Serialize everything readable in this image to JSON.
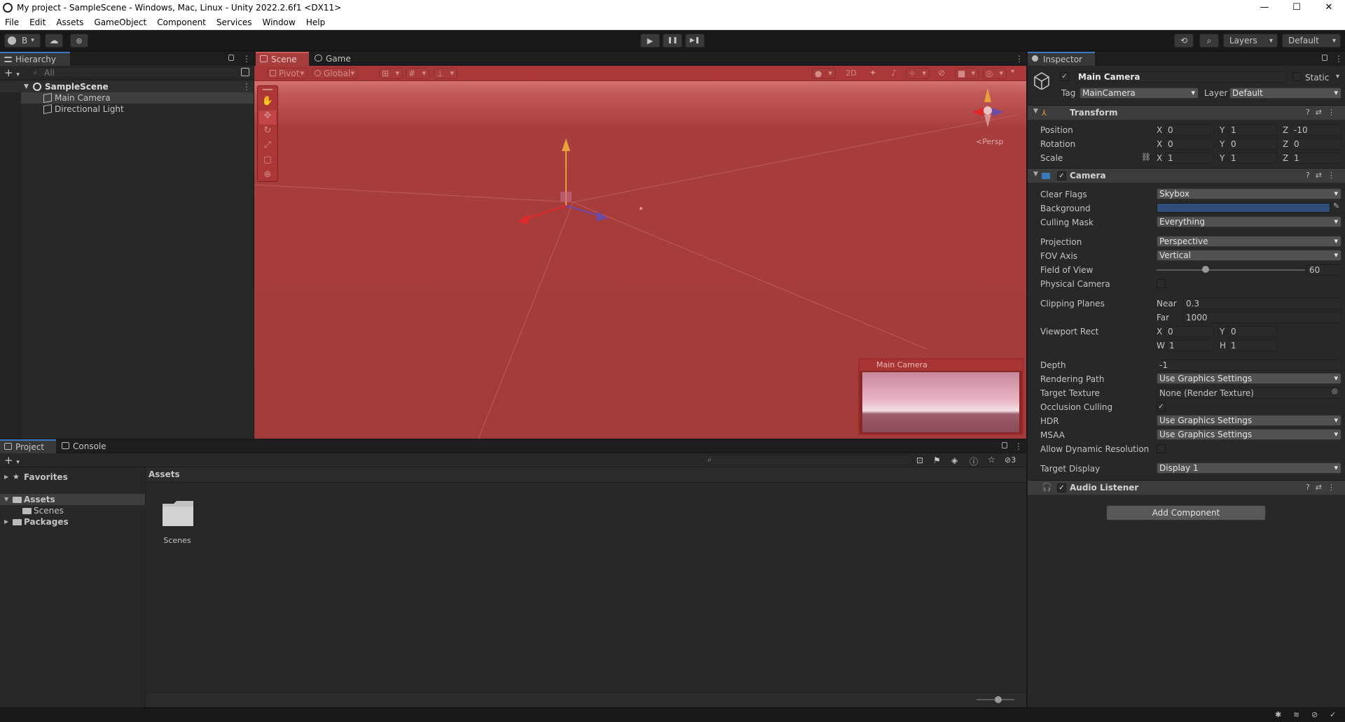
{
  "window": {
    "title": "My project - SampleScene - Windows, Mac, Linux - Unity 2022.2.6f1 <DX11>",
    "min": "—",
    "max": "☐",
    "close": "✕"
  },
  "menu": [
    "File",
    "Edit",
    "Assets",
    "GameObject",
    "Component",
    "Services",
    "Window",
    "Help"
  ],
  "toolbar": {
    "account": "B",
    "layers": "Layers",
    "layout": "Default",
    "play": "▶",
    "pause": "❚❚",
    "step": "▶❚"
  },
  "hierarchy": {
    "tab": "Hierarchy",
    "search_placeholder": "All",
    "scene": "SampleScene",
    "items": [
      "Main Camera",
      "Directional Light"
    ]
  },
  "scene_view": {
    "tabs": [
      "Scene",
      "Game"
    ],
    "pivot": "Pivot",
    "global": "Global",
    "mode_2d": "2D",
    "persp": "<Persp",
    "camera_preview_title": "Main Camera"
  },
  "inspector": {
    "tab": "Inspector",
    "object_name": "Main Camera",
    "static_label": "Static",
    "tag_label": "Tag",
    "tag_value": "MainCamera",
    "layer_label": "Layer",
    "layer_value": "Default",
    "transform": {
      "title": "Transform",
      "position_label": "Position",
      "rotation_label": "Rotation",
      "scale_label": "Scale",
      "position": {
        "x": "0",
        "y": "1",
        "z": "-10"
      },
      "rotation": {
        "x": "0",
        "y": "0",
        "z": "0"
      },
      "scale": {
        "x": "1",
        "y": "1",
        "z": "1"
      }
    },
    "camera": {
      "title": "Camera",
      "clear_flags_label": "Clear Flags",
      "clear_flags": "Skybox",
      "background_label": "Background",
      "background_color": "#314d79",
      "culling_mask_label": "Culling Mask",
      "culling_mask": "Everything",
      "projection_label": "Projection",
      "projection": "Perspective",
      "fov_axis_label": "FOV Axis",
      "fov_axis": "Vertical",
      "fov_label": "Field of View",
      "fov": "60",
      "fov_fraction": 0.33,
      "physical_label": "Physical Camera",
      "clipping_label": "Clipping Planes",
      "near_label": "Near",
      "near": "0.3",
      "far_label": "Far",
      "far": "1000",
      "viewport_label": "Viewport Rect",
      "viewport": {
        "x": "0",
        "y": "0",
        "w": "1",
        "h": "1"
      },
      "depth_label": "Depth",
      "depth": "-1",
      "rendering_path_label": "Rendering Path",
      "rendering_path": "Use Graphics Settings",
      "target_texture_label": "Target Texture",
      "target_texture": "None (Render Texture)",
      "occlusion_label": "Occlusion Culling",
      "hdr_label": "HDR",
      "hdr": "Use Graphics Settings",
      "msaa_label": "MSAA",
      "msaa": "Use Graphics Settings",
      "dynres_label": "Allow Dynamic Resolution",
      "target_display_label": "Target Display",
      "target_display": "Display 1"
    },
    "audio_listener": {
      "title": "Audio Listener"
    },
    "add_component": "Add Component"
  },
  "project": {
    "tabs": [
      "Project",
      "Console"
    ],
    "favorites": "Favorites",
    "assets": "Assets",
    "scenes": "Scenes",
    "packages": "Packages",
    "breadcrumb": "Assets",
    "folder_label": "Scenes",
    "hidden_count": "3"
  },
  "colors": {
    "scene_tint": "#a83d3d",
    "accent": "#3a79bb"
  }
}
